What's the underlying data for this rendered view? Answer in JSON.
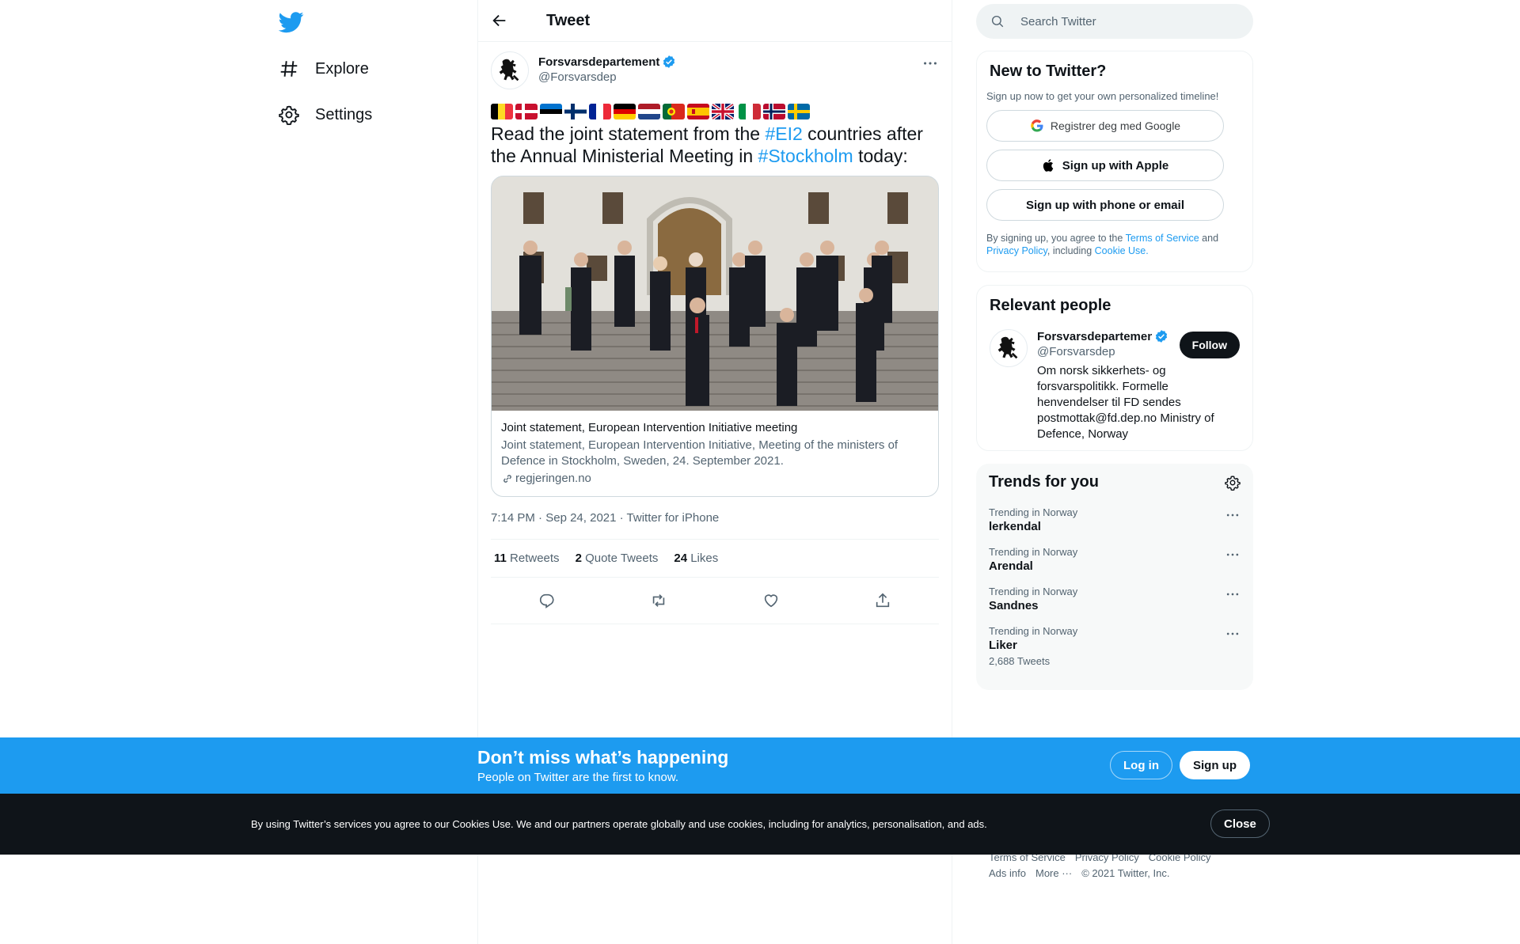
{
  "nav": {
    "explore_label": "Explore",
    "settings_label": "Settings"
  },
  "header": {
    "title": "Tweet"
  },
  "tweet": {
    "author_name": "Forsvarsdepartement",
    "author_handle": "@Forsvarsdep",
    "flags": [
      "belgium",
      "denmark",
      "estonia",
      "finland",
      "france",
      "germany",
      "netherlands",
      "portugal",
      "spain",
      "united-kingdom",
      "italy",
      "norway",
      "sweden"
    ],
    "text_part1": "Read the joint statement from the ",
    "hashtag1": "#EI2",
    "text_part2": " countries after the Annual Ministerial Meeting in ",
    "hashtag2": "#Stockholm",
    "text_part3": " today:",
    "card": {
      "title": "Joint statement, European Intervention Initiative meeting",
      "description": "Joint statement, European Intervention Initiative, Meeting of the ministers of Defence in Stockholm, Sweden, 24. September 2021.",
      "domain": "regjeringen.no"
    },
    "time": "7:14 PM",
    "date": "Sep 24, 2021",
    "source": "Twitter for iPhone",
    "sep": " · ",
    "retweets_count": "11",
    "retweets_label": "Retweets",
    "quotes_count": "2",
    "quotes_label": "Quote Tweets",
    "likes_count": "24",
    "likes_label": "Likes"
  },
  "search": {
    "placeholder": "Search Twitter"
  },
  "new_to_twitter": {
    "title": "New to Twitter?",
    "subtitle": "Sign up now to get your own personalized timeline!",
    "google_label": "Registrer deg med Google",
    "apple_label": "Sign up with Apple",
    "phone_label": "Sign up with phone or email",
    "legal_1": "By signing up, you agree to the ",
    "terms": "Terms of Service",
    "legal_2": " and ",
    "privacy": "Privacy Policy",
    "legal_3": ", including ",
    "cookie_use": "Cookie Use",
    "legal_4": "."
  },
  "relevant": {
    "title": "Relevant people",
    "name": "Forsvarsdepartement",
    "handle": "@Forsvarsdep",
    "follow_label": "Follow",
    "bio": "Om norsk sikkerhets- og forsvarspolitikk. Formelle henvendelser til FD sendes postmottak@fd.dep.no Ministry of Defence, Norway"
  },
  "trends": {
    "title": "Trends for you",
    "items": [
      {
        "context": "Trending in Norway",
        "name": "lerkendal",
        "count": ""
      },
      {
        "context": "Trending in Norway",
        "name": "Arendal",
        "count": ""
      },
      {
        "context": "Trending in Norway",
        "name": "Sandnes",
        "count": ""
      },
      {
        "context": "Trending in Norway",
        "name": "Liker",
        "count": "2,688 Tweets"
      }
    ]
  },
  "footer": {
    "terms": "Terms of Service",
    "privacy": "Privacy Policy",
    "cookie": "Cookie Policy",
    "ads": "Ads info",
    "more": "More ···",
    "copyright": "© 2021 Twitter, Inc."
  },
  "banner": {
    "title": "Don’t miss what’s happening",
    "subtitle": "People on Twitter are the first to know.",
    "login_label": "Log in",
    "signup_label": "Sign up"
  },
  "cookie_bar": {
    "text": "By using Twitter’s services you agree to our Cookies Use. We and our partners operate globally and use cookies, including for analytics, personalisation, and ads.",
    "close_label": "Close"
  },
  "colors": {
    "accent": "#1d9bf0",
    "text": "#0f1419",
    "muted": "#536471"
  }
}
